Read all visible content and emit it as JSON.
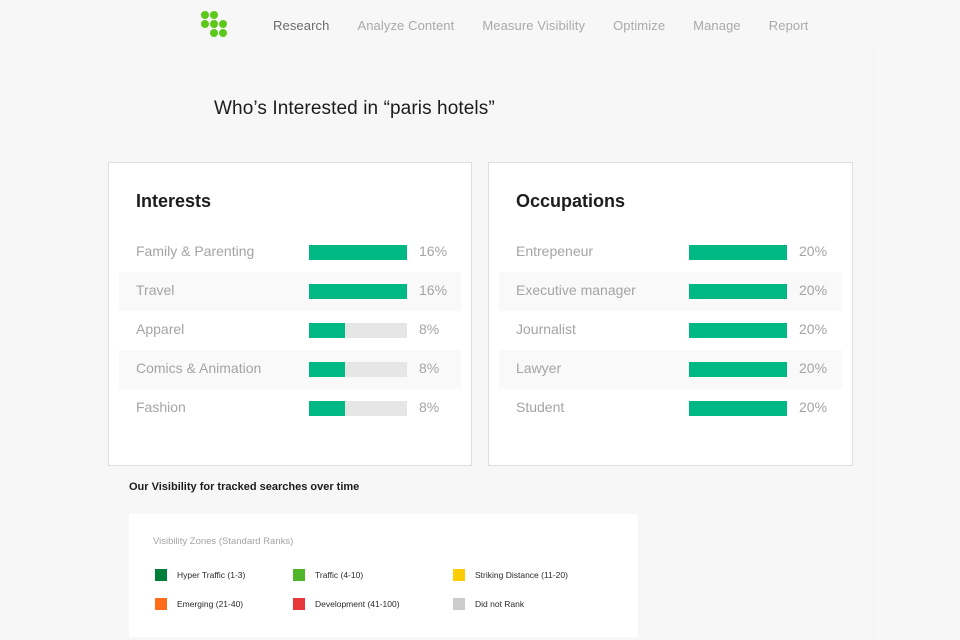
{
  "nav": {
    "logo": "brand-logo",
    "items": [
      {
        "label": "Research",
        "active": true
      },
      {
        "label": "Analyze Content",
        "active": false
      },
      {
        "label": "Measure Visibility",
        "active": false
      },
      {
        "label": "Optimize",
        "active": false
      },
      {
        "label": "Manage",
        "active": false
      },
      {
        "label": "Report",
        "active": false
      }
    ]
  },
  "page": {
    "title": "Who’s Interested in “paris hotels”"
  },
  "colors": {
    "brand": "#5cc81a",
    "bar_fill": "#00b884",
    "bar_track": "#e6e6e6"
  },
  "interests": {
    "title": "Interests",
    "rows": [
      {
        "label": "Family & Parenting",
        "value": "16%",
        "fill": 1.0
      },
      {
        "label": "Travel",
        "value": "16%",
        "fill": 1.0
      },
      {
        "label": "Apparel",
        "value": "8%",
        "fill": 0.37
      },
      {
        "label": "Comics & Animation",
        "value": "8%",
        "fill": 0.37
      },
      {
        "label": "Fashion",
        "value": "8%",
        "fill": 0.37
      }
    ]
  },
  "occupations": {
    "title": "Occupations",
    "rows": [
      {
        "label": "Entrepeneur",
        "value": "20%",
        "fill": 1.0
      },
      {
        "label": "Executive manager",
        "value": "20%",
        "fill": 1.0
      },
      {
        "label": "Journalist",
        "value": "20%",
        "fill": 1.0
      },
      {
        "label": "Lawyer",
        "value": "20%",
        "fill": 1.0
      },
      {
        "label": "Student",
        "value": "20%",
        "fill": 1.0
      }
    ]
  },
  "visibility": {
    "title": "Our Visibility for tracked searches over time",
    "subtitle": "Visibility Zones (Standard Ranks)",
    "legend": [
      {
        "label": "Hyper Traffic (1-3)",
        "color": "#007f3b"
      },
      {
        "label": "Traffic (4-10)",
        "color": "#4fb52a"
      },
      {
        "label": "Striking Distance (11-20)",
        "color": "#ffcc00"
      },
      {
        "label": "Emerging (21-40)",
        "color": "#ff6d1a"
      },
      {
        "label": "Development (41-100)",
        "color": "#e8373a"
      },
      {
        "label": "Did not Rank",
        "color": "#cccccc"
      }
    ]
  }
}
